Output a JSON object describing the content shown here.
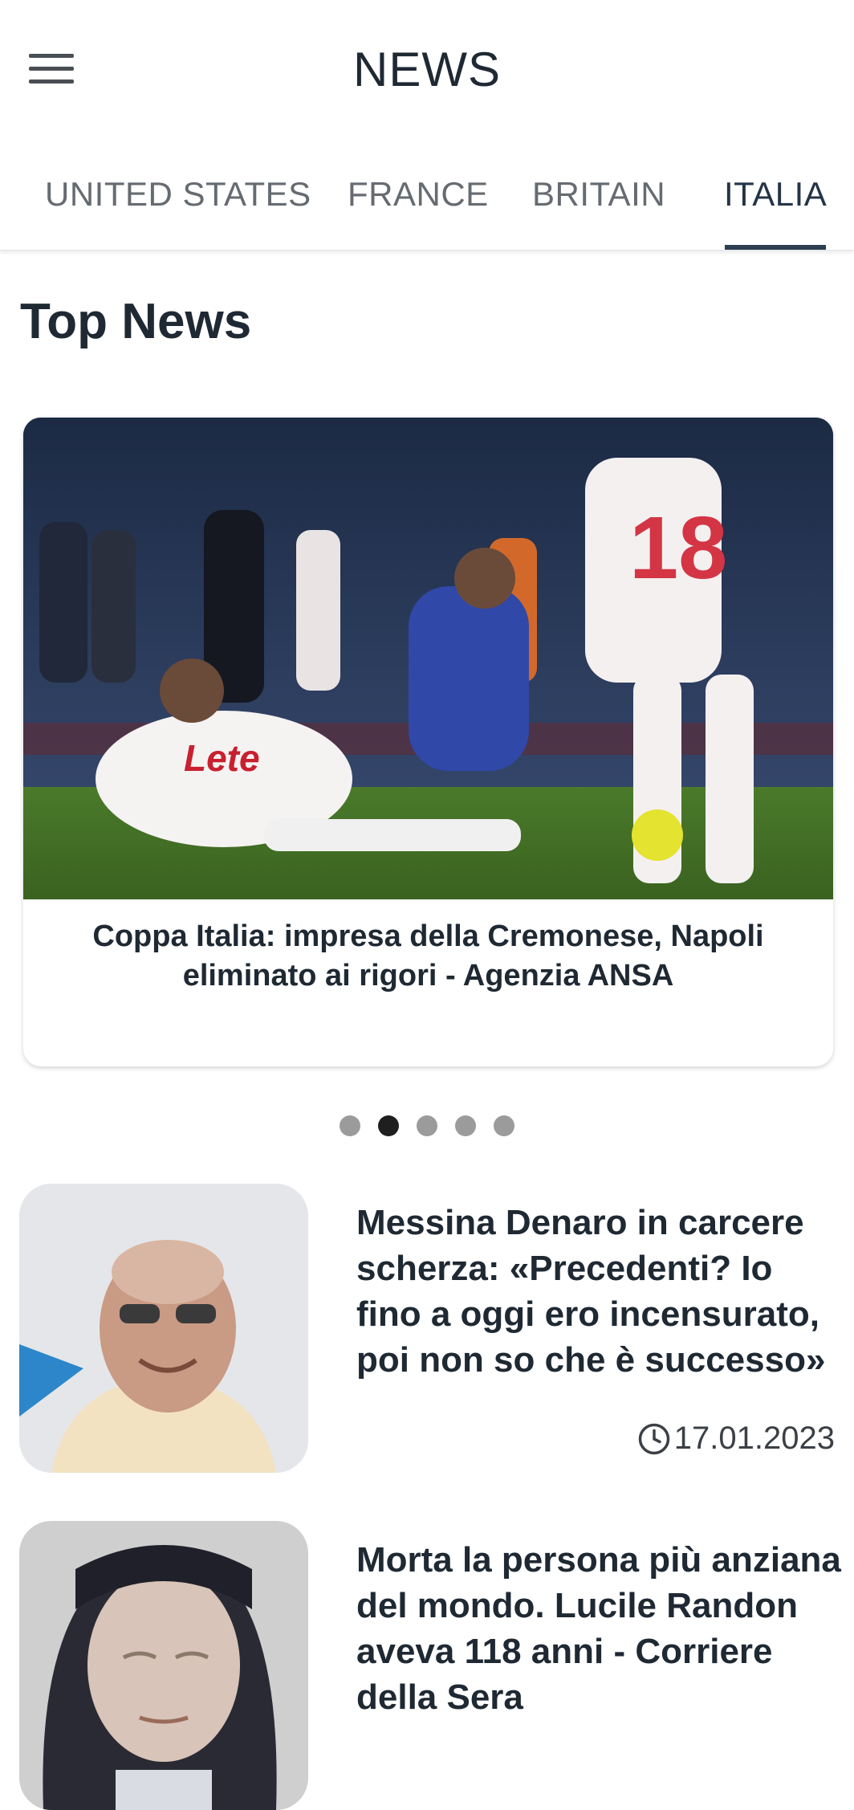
{
  "app": {
    "title": "NEWS"
  },
  "tabs": [
    {
      "label": "UNITED STATES",
      "active": false
    },
    {
      "label": "FRANCE",
      "active": false
    },
    {
      "label": "BRITAIN",
      "active": false
    },
    {
      "label": "ITALIA",
      "active": true
    }
  ],
  "section": {
    "title": "Top News"
  },
  "carousel": {
    "caption": "Coppa Italia: impresa della Cremonese, Napoli eliminato ai rigori - Agenzia ANSA",
    "dots": 5,
    "active_dot": 1
  },
  "news": [
    {
      "title": "Messina Denaro in carcere scherza: «Precedenti? Io fino a oggi ero incensurato, poi non so che è successo»",
      "date": "17.01.2023"
    },
    {
      "title": "Morta la persona più anziana del mondo. Lucile Randon aveva 118 anni - Corriere della Sera",
      "date": ""
    }
  ],
  "colors": {
    "accent": "#2c3e50",
    "text": "#1f2933",
    "tab_inactive": "#666b71"
  }
}
